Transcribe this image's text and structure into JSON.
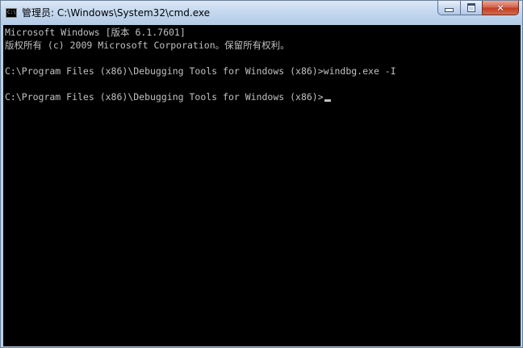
{
  "window": {
    "title": "管理员: C:\\Windows\\System32\\cmd.exe",
    "icon": "cmd-console-icon",
    "icon_text": "C:\\",
    "controls": {
      "minimize_icon": "minimize-icon",
      "maximize_icon": "maximize-icon",
      "close_icon": "close-icon",
      "close_glyph": "✕"
    },
    "colors": {
      "console_background": "#000000",
      "console_text": "#c0c0c0",
      "titlebar": "#c4d8ef",
      "close_button": "#c13f22"
    }
  },
  "console": {
    "lines": [
      "Microsoft Windows [版本 6.1.7601]",
      "版权所有 (c) 2009 Microsoft Corporation。保留所有权利。",
      "",
      "C:\\Program Files (x86)\\Debugging Tools for Windows (x86)>windbg.exe -I",
      "",
      "C:\\Program Files (x86)\\Debugging Tools for Windows (x86)>"
    ]
  }
}
